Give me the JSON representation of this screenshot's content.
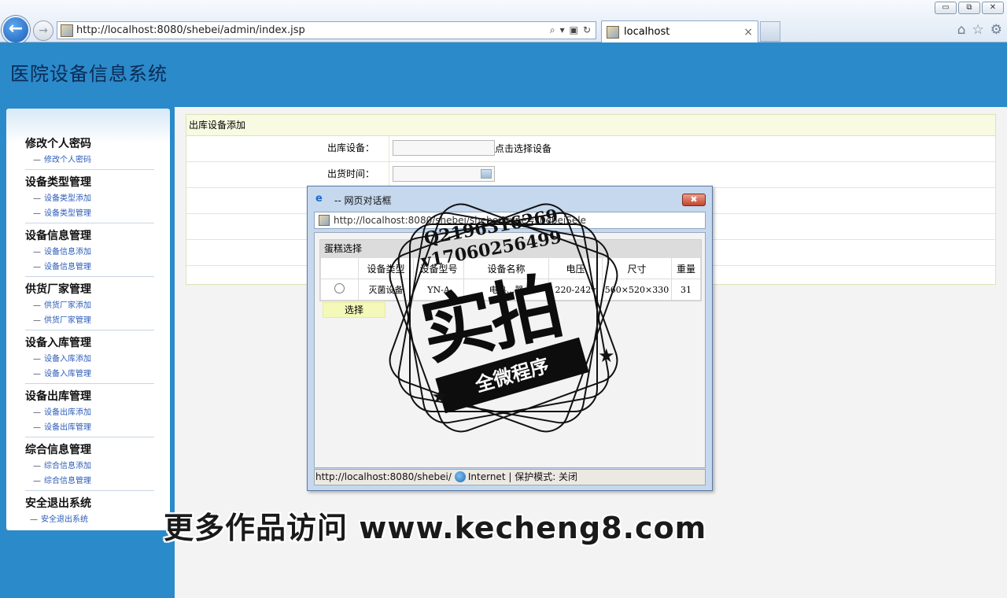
{
  "browser": {
    "address_url": "http://localhost:8080/shebei/admin/index.jsp",
    "tab_title": "localhost",
    "tab_close": "×",
    "window_buttons": [
      "▭",
      "⧉",
      "✕"
    ],
    "back_glyph": "←",
    "fwd_glyph": "→"
  },
  "header": {
    "title": "医院设备信息系统"
  },
  "sidebar": {
    "groups": [
      {
        "title": "修改个人密码",
        "items": [
          "修改个人密码"
        ]
      },
      {
        "title": "设备类型管理",
        "items": [
          "设备类型添加",
          "设备类型管理"
        ]
      },
      {
        "title": "设备信息管理",
        "items": [
          "设备信息添加",
          "设备信息管理"
        ]
      },
      {
        "title": "供货厂家管理",
        "items": [
          "供货厂家添加",
          "供货厂家管理"
        ]
      },
      {
        "title": "设备入库管理",
        "items": [
          "设备入库添加",
          "设备入库管理"
        ]
      },
      {
        "title": "设备出库管理",
        "items": [
          "设备出库添加",
          "设备出库管理"
        ]
      },
      {
        "title": "综合信息管理",
        "items": [
          "综合信息添加",
          "综合信息管理"
        ]
      },
      {
        "title": "安全退出系统",
        "items": [
          "安全退出系统"
        ]
      }
    ]
  },
  "form": {
    "title": "出库设备添加",
    "device_label": "出库设备：",
    "device_pick": "点击选择设备",
    "time_label": "出货时间："
  },
  "dialog": {
    "title": "-- 网页对话框",
    "close": "✖",
    "url": "http://localhost:8080/shebei/shebei?type=shebeiSele",
    "pick_title": "蛋糕选择",
    "columns": [
      "",
      "设备类型",
      "设备型号",
      "设备名称",
      "电压",
      "尺寸",
      "重量"
    ],
    "rows": [
      [
        "",
        "灭菌设备",
        "YN-A",
        "电热...器",
        "220-242v",
        "560×520×330",
        "31"
      ]
    ],
    "select_button": "选择",
    "status_url": "http://localhost:8080/shebei/",
    "status_zone": "Internet | 保护模式: 关闭"
  },
  "watermark": {
    "qq": "Q2196316269",
    "phone": "v17060256499",
    "big": "实拍",
    "banner": "全微程序",
    "footer": "更多作品访问 www.kecheng8.com"
  }
}
